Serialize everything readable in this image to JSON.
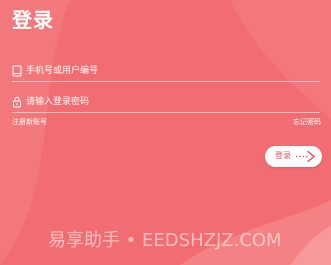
{
  "header": {
    "title": "登录"
  },
  "form": {
    "phone": {
      "placeholder": "手机号或用户编号",
      "value": ""
    },
    "password": {
      "placeholder": "请输入登录密码",
      "value": ""
    }
  },
  "links": {
    "register": "注册新账号",
    "forgot": "忘记密码"
  },
  "login_button": {
    "label": "登录"
  },
  "icons": {
    "phone": "phone-icon",
    "lock": "lock-icon",
    "arrow": "arrow-right-icon"
  },
  "watermark": {
    "text": "易享助手 • EEDSHZJZ.COM"
  },
  "colors": {
    "background": "#f26d72",
    "accent": "#e0505a",
    "text": "#ffffff"
  }
}
